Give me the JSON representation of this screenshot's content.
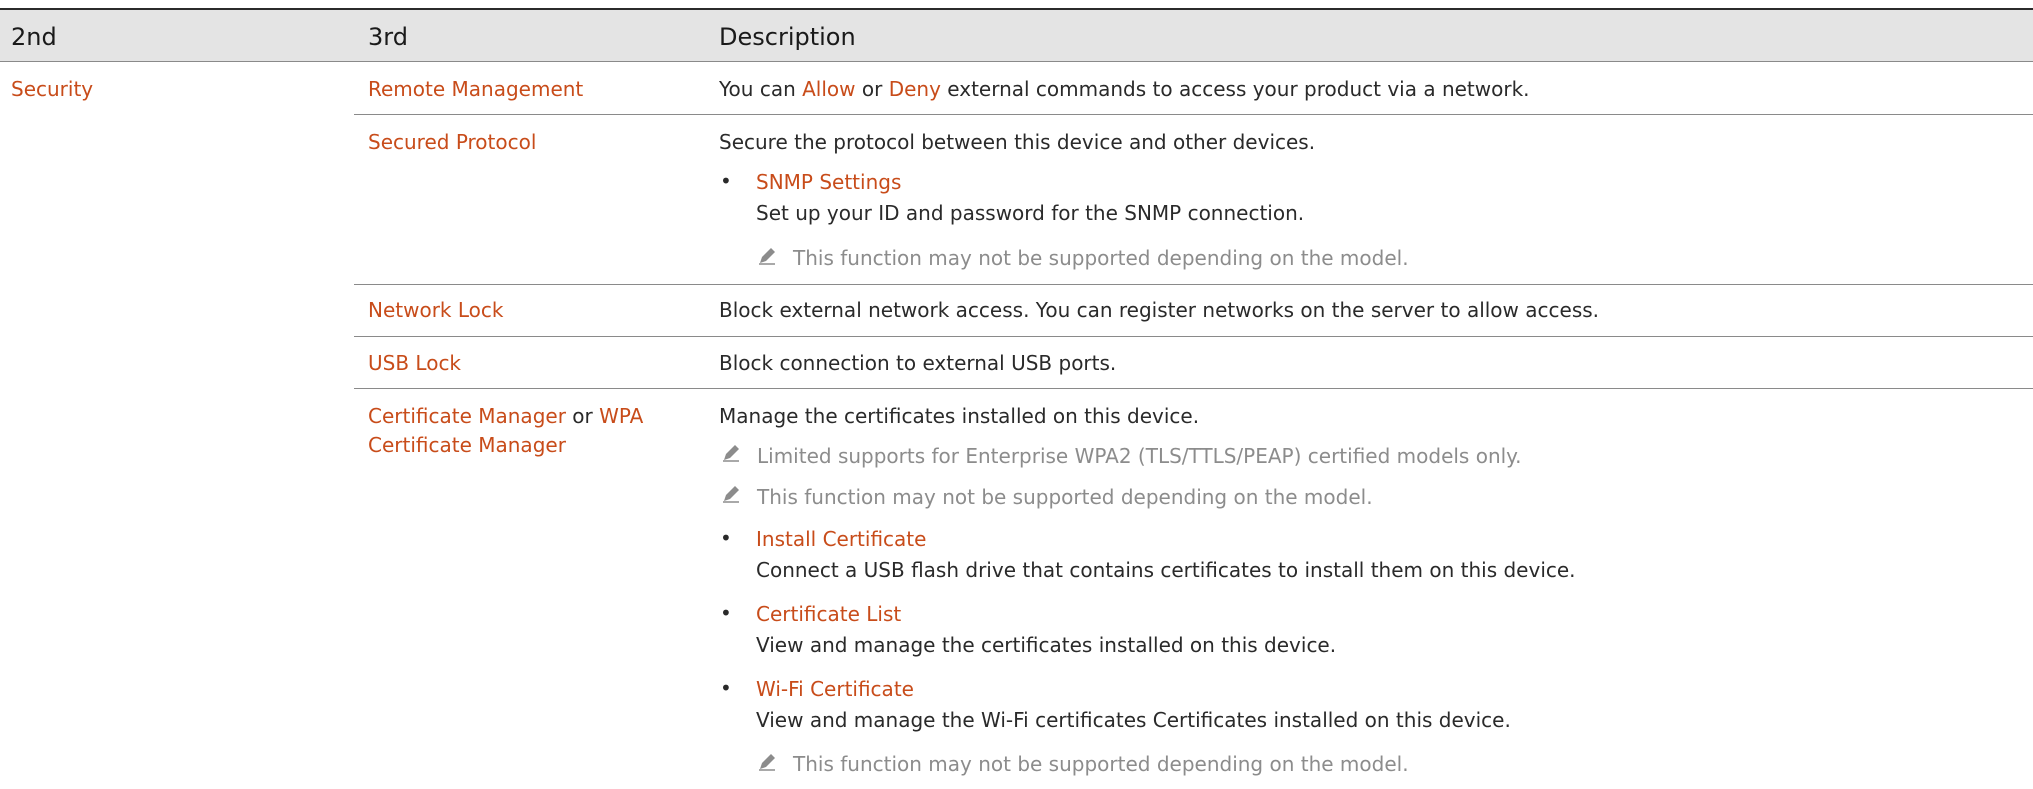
{
  "table": {
    "headers": [
      "2nd",
      "3rd",
      "Description"
    ],
    "category": "Security",
    "rows": [
      {
        "name": "Remote Management",
        "desc_parts": [
          "You can ",
          "Allow",
          " or ",
          "Deny",
          " external commands to access your product via a network."
        ]
      },
      {
        "name": "Secured Protocol",
        "desc": "Secure the protocol between this device and other devices.",
        "bullet_title": "SNMP Settings",
        "bullet_text": "Set up your ID and password for the SNMP connection.",
        "note": "This function may not be supported depending on the model."
      },
      {
        "name": "Network Lock",
        "desc": "Block external network access. You can register networks on the server to allow access."
      },
      {
        "name": "USB Lock",
        "desc": "Block connection to external USB ports."
      },
      {
        "name_parts": [
          "Certificate Manager",
          " or ",
          "WPA",
          "Certificate Manager"
        ],
        "desc": "Manage the certificates installed on this device.",
        "notes": [
          "Limited supports for Enterprise WPA2 (TLS/TTLS/PEAP) certified models only.",
          "This function may not be supported depending on the model."
        ],
        "bullets": [
          {
            "title": "Install Certificate",
            "text": "Connect a USB flash drive that contains certificates to install them on this device."
          },
          {
            "title": "Certificate List",
            "text": "View and manage the certificates installed on this device."
          },
          {
            "title": "Wi-Fi Certificate",
            "text": "View and manage the Wi-Fi certificates Certificates installed on this device."
          }
        ],
        "final_note": "This function may not be supported depending on the model."
      }
    ]
  },
  "colors": {
    "accent": "#c84c1a",
    "note_gray": "#8c8c8c",
    "header_bg": "#e4e4e4"
  },
  "icons": {
    "note": "pencil-icon",
    "bullet": "bullet-dot"
  }
}
